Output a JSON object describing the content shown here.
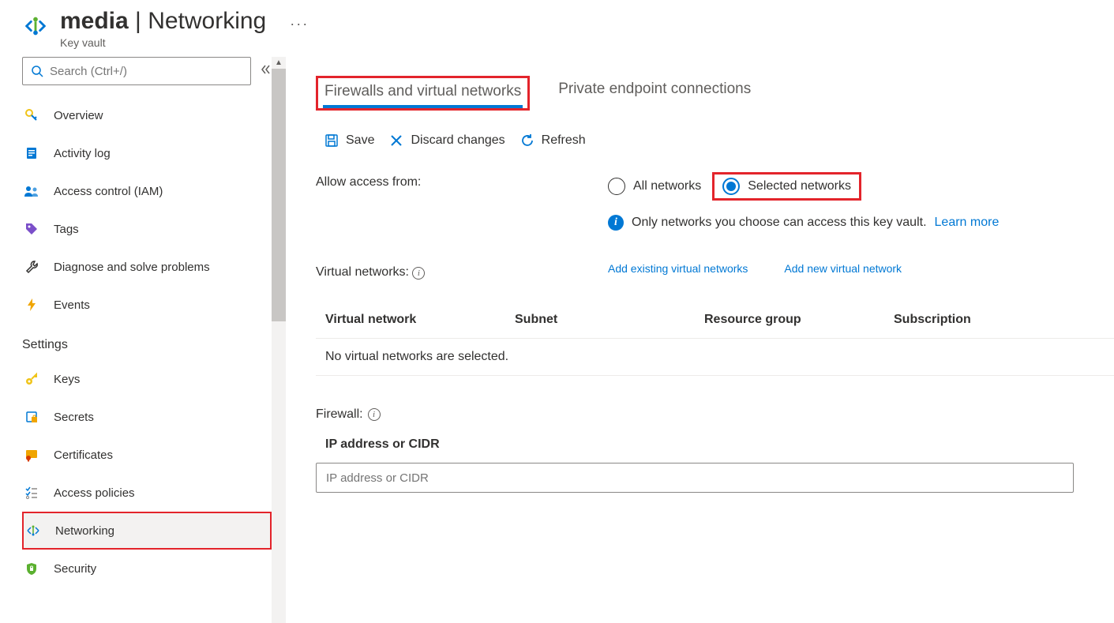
{
  "header": {
    "resource_name": "media",
    "page_title": "Networking",
    "resource_type": "Key vault"
  },
  "sidebar": {
    "search_placeholder": "Search (Ctrl+/)",
    "items": [
      {
        "key": "overview",
        "label": "Overview"
      },
      {
        "key": "activity-log",
        "label": "Activity log"
      },
      {
        "key": "access-control",
        "label": "Access control (IAM)"
      },
      {
        "key": "tags",
        "label": "Tags"
      },
      {
        "key": "diagnose",
        "label": "Diagnose and solve problems"
      },
      {
        "key": "events",
        "label": "Events"
      }
    ],
    "settings_label": "Settings",
    "settings_items": [
      {
        "key": "keys",
        "label": "Keys"
      },
      {
        "key": "secrets",
        "label": "Secrets"
      },
      {
        "key": "certificates",
        "label": "Certificates"
      },
      {
        "key": "access-policies",
        "label": "Access policies"
      },
      {
        "key": "networking",
        "label": "Networking"
      },
      {
        "key": "security",
        "label": "Security"
      }
    ]
  },
  "tabs": {
    "firewalls": "Firewalls and virtual networks",
    "private_endpoint": "Private endpoint connections"
  },
  "toolbar": {
    "save": "Save",
    "discard": "Discard changes",
    "refresh": "Refresh"
  },
  "access": {
    "label": "Allow access from:",
    "all_networks": "All networks",
    "selected_networks": "Selected networks",
    "info_text": "Only networks you choose can access this key vault.",
    "learn_more": "Learn more"
  },
  "vnets": {
    "label": "Virtual networks:",
    "add_existing": "Add existing virtual networks",
    "add_new": "Add new virtual network",
    "columns": {
      "vnet": "Virtual network",
      "subnet": "Subnet",
      "rg": "Resource group",
      "sub": "Subscription"
    },
    "empty": "No virtual networks are selected."
  },
  "firewall": {
    "label": "Firewall:",
    "ip_col": "IP address or CIDR",
    "ip_placeholder": "IP address or CIDR"
  }
}
